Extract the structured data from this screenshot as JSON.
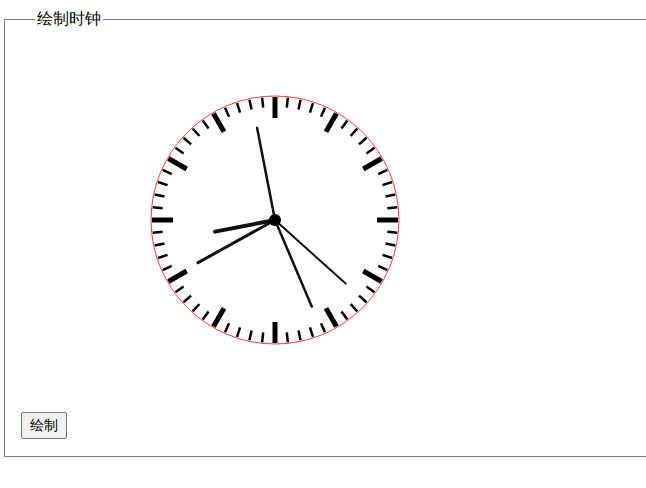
{
  "legend": "绘制时钟",
  "clock": {
    "hands": [
      {
        "angle": 349,
        "length": 94,
        "width": 2.5
      },
      {
        "angle": 259,
        "length": 61,
        "width": 4
      },
      {
        "angle": 241,
        "length": 88,
        "width": 3
      },
      {
        "angle": 157,
        "length": 94,
        "width": 2.5
      },
      {
        "angle": 132,
        "length": 95,
        "width": 2
      }
    ]
  },
  "button": "绘制"
}
